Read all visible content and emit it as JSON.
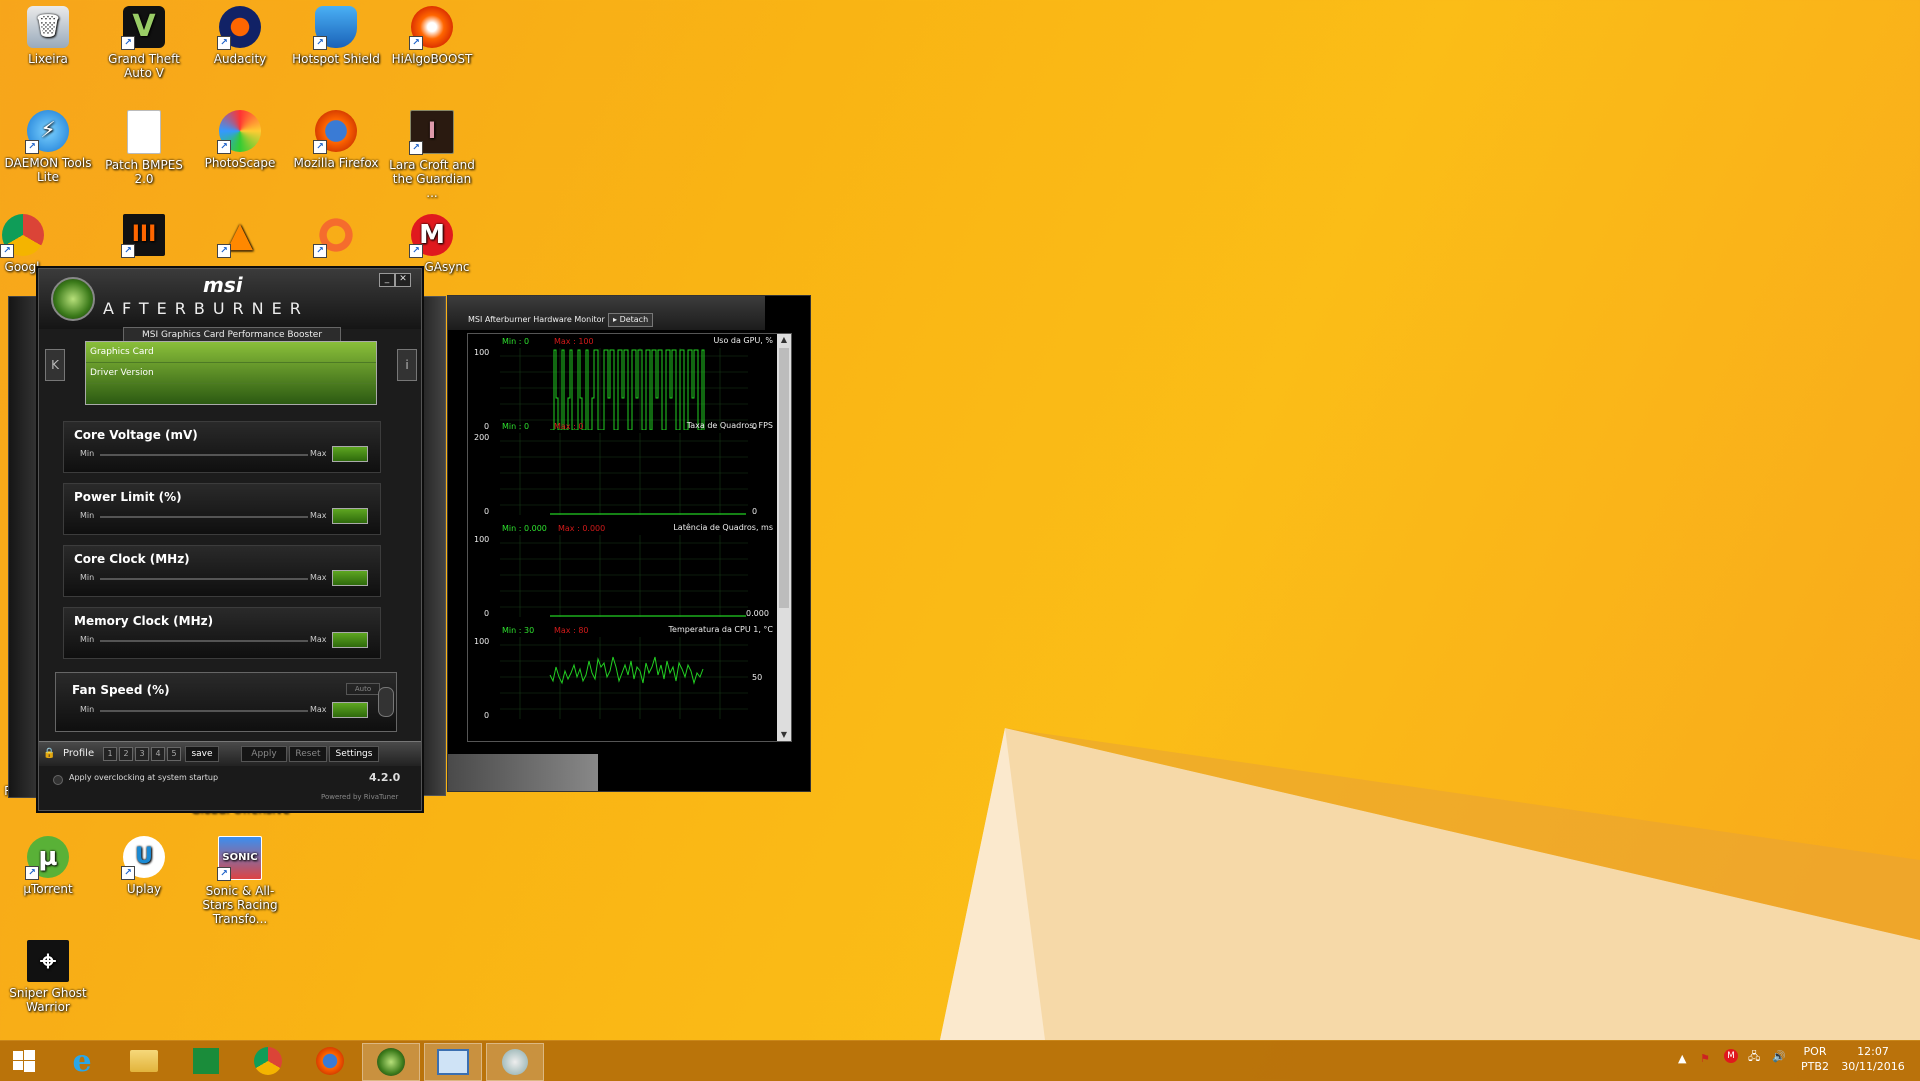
{
  "desktop": {
    "icons": [
      {
        "label": "Lixeira"
      },
      {
        "label": "Grand Theft Auto V"
      },
      {
        "label": "Audacity"
      },
      {
        "label": "Hotspot Shield"
      },
      {
        "label": "HiAlgoBOOST"
      },
      {
        "label": "DAEMON Tools Lite"
      },
      {
        "label": "Patch BMPES 2.0"
      },
      {
        "label": "PhotoScape"
      },
      {
        "label": "Mozilla Firefox"
      },
      {
        "label": "Lara Croft and the Guardian ..."
      },
      {
        "label": "Googl"
      },
      {
        "label": ""
      },
      {
        "label": ""
      },
      {
        "label": ""
      },
      {
        "label": "GAsync"
      },
      {
        "label": "Rocke"
      },
      {
        "label": "Global Offensive"
      },
      {
        "label": "µTorrent"
      },
      {
        "label": "Uplay"
      },
      {
        "label": "Sonic & All-Stars Racing Transfo..."
      },
      {
        "label": "Sniper Ghost Warrior"
      }
    ]
  },
  "afterburner": {
    "brand": "msi",
    "title": "AFTERBURNER",
    "subtitle": "MSI Graphics Card Performance Booster",
    "info": {
      "graphics_card": "Graphics Card",
      "driver_version": "Driver Version"
    },
    "side_left": "K",
    "side_right": "i",
    "sliders": [
      {
        "label": "Core Voltage (mV)",
        "min": "Min",
        "max": "Max"
      },
      {
        "label": "Power Limit (%)",
        "min": "Min",
        "max": "Max"
      },
      {
        "label": "Core Clock (MHz)",
        "min": "Min",
        "max": "Max"
      },
      {
        "label": "Memory Clock (MHz)",
        "min": "Min",
        "max": "Max"
      },
      {
        "label": "Fan Speed (%)",
        "min": "Min",
        "max": "Max",
        "auto": "Auto"
      }
    ],
    "footer": {
      "profile": "Profile",
      "profile_slots": [
        "1",
        "2",
        "3",
        "4",
        "5"
      ],
      "save": "save",
      "apply": "Apply",
      "reset": "Reset",
      "settings": "Settings",
      "startup": "Apply overclocking at system startup",
      "version": "4.2.0",
      "powered": "Powered by RivaTuner"
    }
  },
  "monitor": {
    "title": "MSI Afterburner Hardware Monitor",
    "detach": "Detach",
    "graphs": [
      {
        "min": "Min : 0",
        "max": "Max : 100",
        "name": "Uso da GPU, %",
        "top": "100",
        "bottom": "0",
        "current": "0"
      },
      {
        "min": "Min : 0",
        "max": "Max : 0",
        "name": "Taxa de Quadros, FPS",
        "top": "200",
        "bottom": "0",
        "current": "0"
      },
      {
        "min": "Min : 0.000",
        "max": "Max : 0.000",
        "name": "Latência de Quadros, ms",
        "top": "100",
        "bottom": "0",
        "current": "0.000"
      },
      {
        "min": "Min : 30",
        "max": "Max : 80",
        "name": "Temperatura da CPU 1, °C",
        "top": "100",
        "bottom": "0",
        "current": "50"
      }
    ]
  },
  "taskbar": {
    "apps": [
      "start",
      "internet-explorer",
      "file-explorer",
      "store",
      "chrome",
      "firefox",
      "msi-afterburner",
      "hardware-monitor",
      "control-panel"
    ],
    "lang_top": "POR",
    "lang_bottom": "PTB2",
    "time": "12:07",
    "date": "30/11/2016"
  },
  "colors": {
    "accent_green": "#2ee02e",
    "max_red": "#d21a1a",
    "wallpaper": "#f9b414"
  }
}
